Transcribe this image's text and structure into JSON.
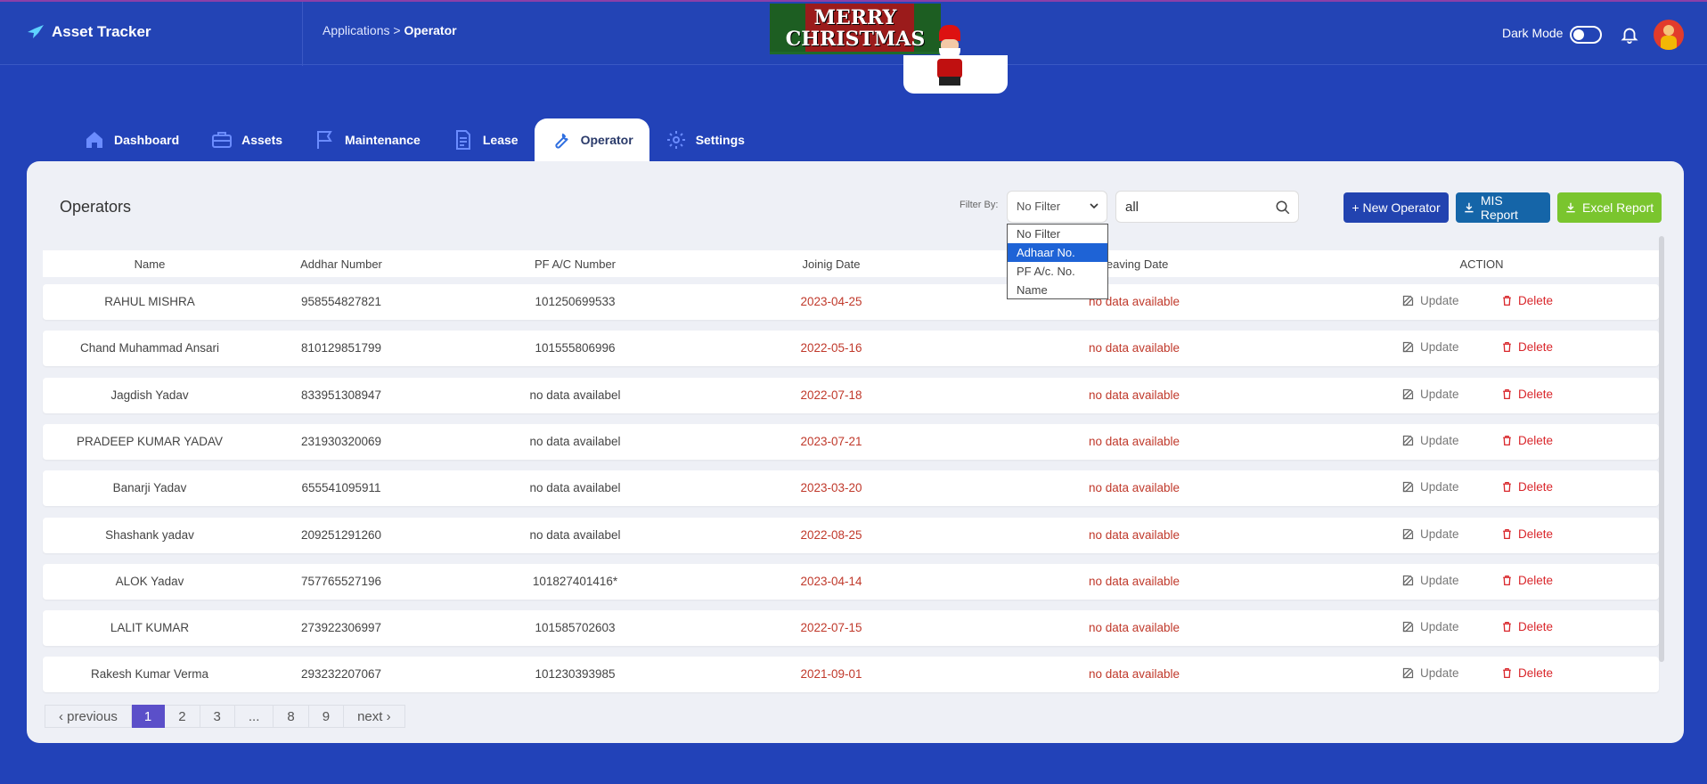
{
  "app": {
    "title": "Asset Tracker"
  },
  "breadcrumb": {
    "parent": "Applications",
    "separator": ">",
    "current": "Operator"
  },
  "banner": {
    "line1": "MERRY",
    "line2": "CHRISTMAS"
  },
  "header": {
    "dark_mode_label": "Dark Mode",
    "dark_mode_on": false
  },
  "tabs": [
    {
      "label": "Dashboard",
      "icon": "home-icon"
    },
    {
      "label": "Assets",
      "icon": "briefcase-icon"
    },
    {
      "label": "Maintenance",
      "icon": "flag-icon"
    },
    {
      "label": "Lease",
      "icon": "document-icon"
    },
    {
      "label": "Operator",
      "icon": "wrench-icon",
      "active": true
    },
    {
      "label": "Settings",
      "icon": "gear-icon"
    }
  ],
  "page": {
    "title": "Operators",
    "filter_label": "Filter By:",
    "filter_value": "No Filter",
    "filter_options": [
      "No Filter",
      "Adhaar No.",
      "PF A/c. No.",
      "Name"
    ],
    "filter_highlighted": "Adhaar No.",
    "search_value": "all",
    "buttons": {
      "new": "+ New Operator",
      "mis": "MIS Report",
      "excel": "Excel Report"
    }
  },
  "table": {
    "headers": [
      "Name",
      "Addhar Number",
      "PF A/C Number",
      "Joinig Date",
      "Leaving Date",
      "ACTION"
    ],
    "update_label": "Update",
    "delete_label": "Delete",
    "rows": [
      {
        "name": "RAHUL MISHRA",
        "addhar": "958554827821",
        "pf": "101250699533",
        "join": "2023-04-25",
        "leave": "no data available"
      },
      {
        "name": "Chand Muhammad Ansari",
        "addhar": "810129851799",
        "pf": "101555806996",
        "join": "2022-05-16",
        "leave": "no data available"
      },
      {
        "name": "Jagdish Yadav",
        "addhar": "833951308947",
        "pf": "no data availabel",
        "join": "2022-07-18",
        "leave": "no data available"
      },
      {
        "name": "PRADEEP KUMAR YADAV",
        "addhar": "231930320069",
        "pf": "no data availabel",
        "join": "2023-07-21",
        "leave": "no data available"
      },
      {
        "name": "Banarji Yadav",
        "addhar": "655541095911",
        "pf": "no data availabel",
        "join": "2023-03-20",
        "leave": "no data available"
      },
      {
        "name": "Shashank yadav",
        "addhar": "209251291260",
        "pf": "no data availabel",
        "join": "2022-08-25",
        "leave": "no data available"
      },
      {
        "name": "ALOK Yadav",
        "addhar": "757765527196",
        "pf": "101827401416*",
        "join": "2023-04-14",
        "leave": "no data available"
      },
      {
        "name": "LALIT KUMAR",
        "addhar": "273922306997",
        "pf": "101585702603",
        "join": "2022-07-15",
        "leave": "no data available"
      },
      {
        "name": "Rakesh Kumar Verma",
        "addhar": "293232207067",
        "pf": "101230393985",
        "join": "2021-09-01",
        "leave": "no data available"
      }
    ]
  },
  "pagination": {
    "previous": "‹ previous",
    "pages": [
      "1",
      "2",
      "3",
      "...",
      "8",
      "9"
    ],
    "current": "1",
    "next": "next ›"
  },
  "colors": {
    "primary": "#2242b8",
    "danger": "#d9262b",
    "excel": "#7ac52e",
    "mis": "#1565a8"
  }
}
